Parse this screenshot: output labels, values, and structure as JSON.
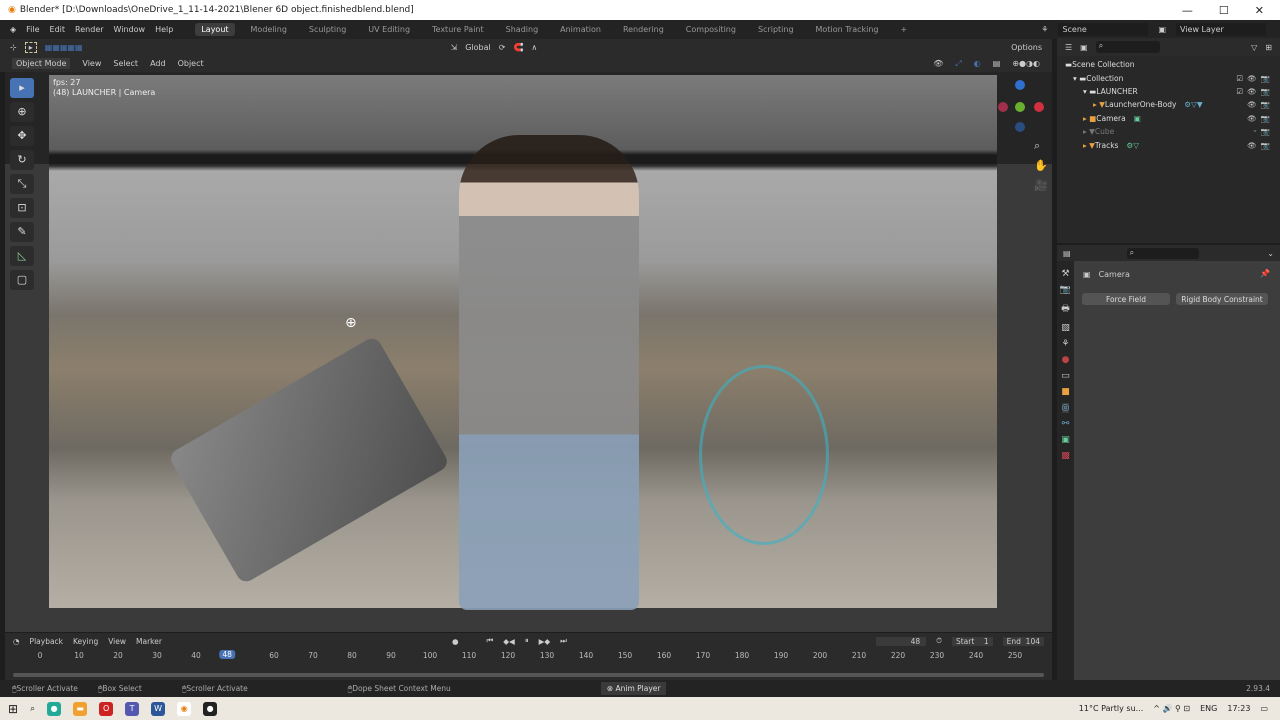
{
  "window": {
    "title": "Blender* [D:\\Downloads\\OneDrive_1_11-14-2021\\Blener 6D object.finishedblend.blend]",
    "controls": [
      "—",
      "☐",
      "✕"
    ]
  },
  "menu": [
    "File",
    "Edit",
    "Render",
    "Window",
    "Help"
  ],
  "workspaces": [
    "Layout",
    "Modeling",
    "Sculpting",
    "UV Editing",
    "Texture Paint",
    "Shading",
    "Animation",
    "Rendering",
    "Compositing",
    "Scripting",
    "Motion Tracking",
    "+"
  ],
  "scene": {
    "scene": "Scene",
    "view_layer": "View Layer"
  },
  "toolheader": {
    "orientation": "Global",
    "options": "Options"
  },
  "viewport_header": {
    "mode": "Object Mode",
    "items": [
      "View",
      "Select",
      "Add",
      "Object"
    ]
  },
  "viewport": {
    "fps": "fps: 27",
    "info": "(48) LAUNCHER | Camera"
  },
  "outliner": {
    "root": "Scene Collection",
    "items": [
      {
        "name": "Collection",
        "icon": "collection-icon"
      },
      {
        "name": "LAUNCHER",
        "icon": "collection-icon"
      },
      {
        "name": "LauncherOne-Body",
        "icon": "mesh-icon"
      },
      {
        "name": "Camera",
        "icon": "camera-icon"
      },
      {
        "name": "Cube",
        "icon": "mesh-icon"
      },
      {
        "name": "Tracks",
        "icon": "mesh-icon"
      }
    ]
  },
  "properties": {
    "object": "Camera",
    "buttons": [
      "Force Field",
      "Rigid Body Constraint"
    ]
  },
  "timeline": {
    "menus": [
      "Playback",
      "Keying",
      "View",
      "Marker"
    ],
    "current_frame": "48",
    "start_label": "Start",
    "start": "1",
    "end_label": "End",
    "end": "104",
    "ticks": [
      "0",
      "10",
      "20",
      "30",
      "40",
      "60",
      "70",
      "80",
      "90",
      "100",
      "110",
      "120",
      "130",
      "140",
      "150",
      "160",
      "170",
      "180",
      "190",
      "200",
      "210",
      "220",
      "230",
      "240",
      "250"
    ]
  },
  "status": {
    "items": [
      "Scroller Activate",
      "Box Select",
      "Scroller Activate",
      "Dope Sheet Context Menu",
      "Anim Player"
    ],
    "version": "2.93.4"
  },
  "taskbar": {
    "weather": "11°C  Partly su...",
    "lang": "ENG",
    "time": "17:23"
  },
  "colors": {
    "accent": "#4772b3",
    "bg": "#303030"
  }
}
